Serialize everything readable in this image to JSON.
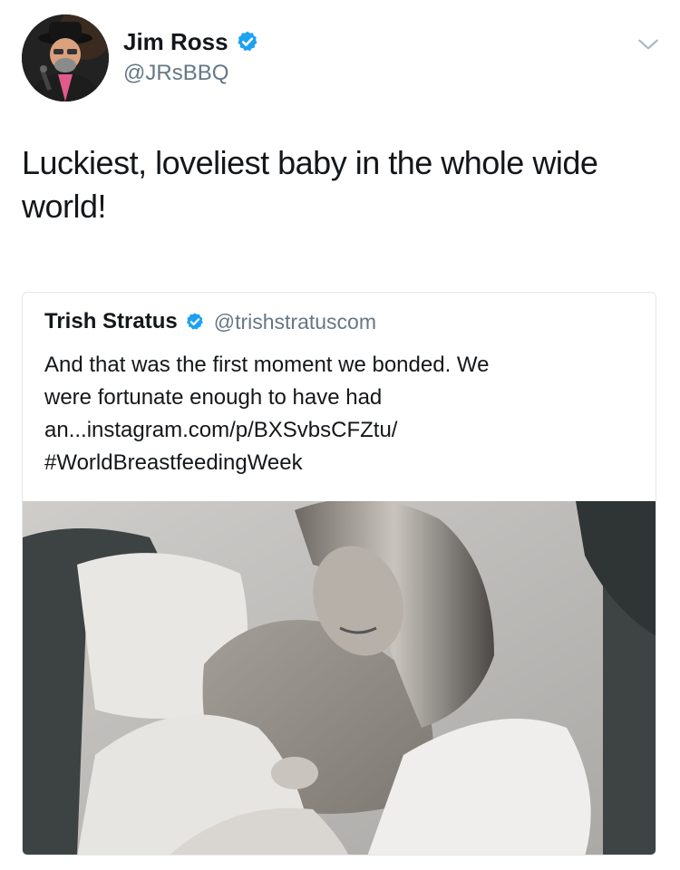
{
  "tweet": {
    "author": {
      "name": "Jim Ross",
      "handle": "@JRsBBQ",
      "verified": true
    },
    "text": "Luckiest, loveliest baby in the whole wide world!",
    "menu_icon": "chevron-down-icon"
  },
  "quoted_tweet": {
    "author": {
      "name": "Trish Stratus",
      "handle": "@trishstratuscom",
      "verified": true
    },
    "text_lines": [
      "And that was the first moment we bonded. We",
      "were fortunate enough to have had",
      "an...instagram.com/p/BXSvbsCFZtu/",
      "#WorldBreastfeedingWeek"
    ]
  },
  "colors": {
    "primary_text": "#14171a",
    "secondary_text": "#657786",
    "verified_blue": "#1da1f2",
    "card_border": "#e1e8ed"
  }
}
